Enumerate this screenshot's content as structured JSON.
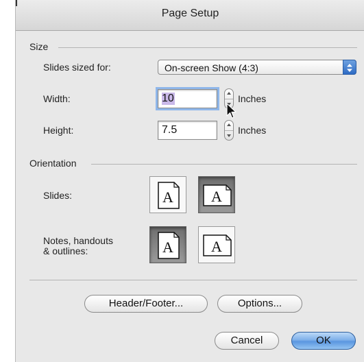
{
  "window": {
    "title": "Page Setup"
  },
  "size": {
    "section_label": "Size",
    "slides_sized_for_label": "Slides sized for:",
    "slides_sized_for_value": "On-screen Show (4:3)",
    "width_label": "Width:",
    "width_value": "10",
    "height_label": "Height:",
    "height_value": "7.5",
    "unit_label": "Inches"
  },
  "orientation": {
    "section_label": "Orientation",
    "slides_label": "Slides:",
    "notes_label_line1": "Notes, handouts",
    "notes_label_line2": "& outlines:",
    "slides_selected": "landscape",
    "notes_selected": "portrait",
    "page_glyph": "A"
  },
  "buttons": {
    "header_footer": "Header/Footer...",
    "options": "Options...",
    "cancel": "Cancel",
    "ok": "OK"
  },
  "icons": {
    "popup": "updown-arrows-icon",
    "stepper": "stepper-arrows-icon",
    "portrait": "portrait-page-icon",
    "landscape": "landscape-page-icon",
    "cursor": "arrow-cursor-icon"
  },
  "colors": {
    "default_button": "#5a96e0",
    "popup_arrows": "#2e6bc4",
    "focus_ring": "#8fb7ea",
    "text_selection": "#c9b8e8"
  }
}
